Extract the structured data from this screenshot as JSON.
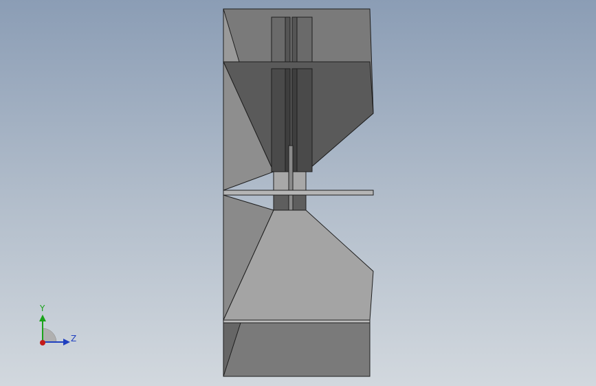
{
  "viewport": {
    "background_top": "#8b9db5",
    "background_bottom": "#d2d8de"
  },
  "model": {
    "part": "fan-impeller-section",
    "colors": {
      "dark_face": "#5a5a5a",
      "mid_face": "#7a7a7a",
      "light_face": "#a0a0a0",
      "edge": "#1e1e1e"
    }
  },
  "triad": {
    "y_label": "Y",
    "z_label": "Z",
    "y_color": "#1aa31a",
    "z_color": "#1f3fbf",
    "x_color": "#c41a1a"
  }
}
